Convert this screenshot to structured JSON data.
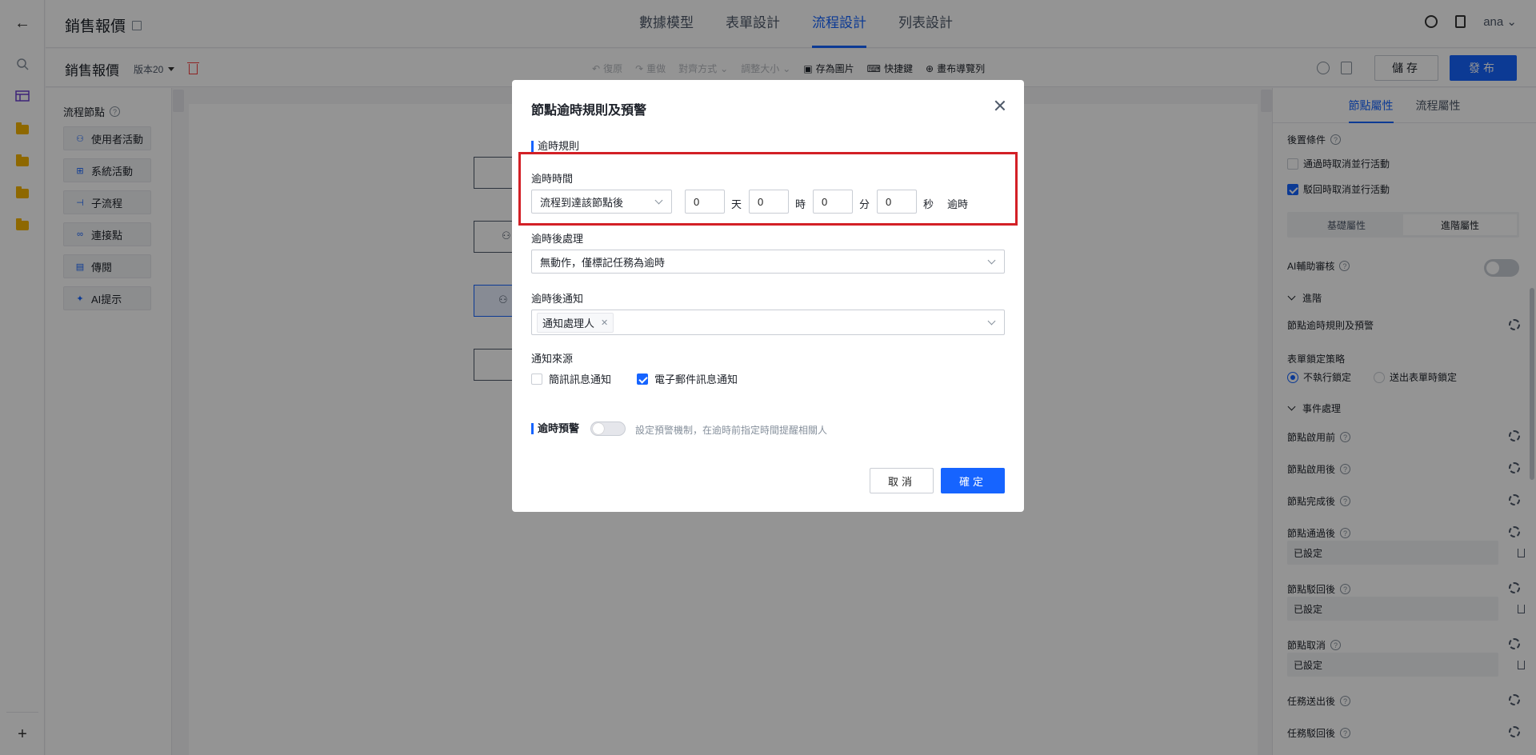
{
  "app": {
    "title": "銷售報價"
  },
  "nav": {
    "tabs": [
      "數據模型",
      "表單設計",
      "流程設計",
      "列表設計"
    ],
    "active": "流程設計"
  },
  "user": {
    "name": "ana"
  },
  "toolbar": {
    "doc_title": "銷售報價",
    "version": "版本20",
    "undo": "復原",
    "redo": "重做",
    "align": "對齊方式",
    "resize": "調整大小",
    "save_image": "存為圖片",
    "shortcuts": "快捷鍵",
    "guide": "畫布導覽列",
    "save": "儲存",
    "publish": "發布"
  },
  "nodes": {
    "title": "流程節點",
    "items": [
      {
        "label": "使用者活動",
        "icon": "user-icon"
      },
      {
        "label": "系統活動",
        "icon": "grid-icon"
      },
      {
        "label": "子流程",
        "icon": "subflow-icon"
      },
      {
        "label": "連接點",
        "icon": "link-icon"
      },
      {
        "label": "傳閱",
        "icon": "circulate-icon"
      },
      {
        "label": "AI提示",
        "icon": "ai-icon"
      }
    ]
  },
  "rpanel": {
    "tabs": [
      "節點屬性",
      "流程屬性"
    ],
    "post_condition": "後置條件",
    "cb1": "通過時取消並行活動",
    "cb2": "駁回時取消並行活動",
    "seg": [
      "基礎屬性",
      "進階屬性"
    ],
    "ai_review": "AI輔助審核",
    "advanced": "進階",
    "node_overtime": "節點逾時規則及預警",
    "lock_policy": "表單鎖定策略",
    "lock_opt1": "不執行鎖定",
    "lock_opt2": "送出表單時鎖定",
    "events": "事件處理",
    "e1": "節點啟用前",
    "e2": "節點啟用後",
    "e3": "節點完成後",
    "e4": "節點通過後",
    "e5": "節點駁回後",
    "e6": "節點取消",
    "e7": "任務送出後",
    "e8": "任務駁回後",
    "set": "已設定"
  },
  "modal": {
    "title": "節點逾時規則及預警",
    "sec_rule": "逾時規則",
    "overtime_label": "逾時時間",
    "base_select": "流程到達該節點後",
    "days": "0",
    "days_unit": "天",
    "hours": "0",
    "hours_unit": "時",
    "minutes": "0",
    "minutes_unit": "分",
    "seconds": "0",
    "seconds_unit": "秒",
    "suffix": "逾時",
    "after_label": "逾時後處理",
    "after_value": "無動作，僅標記任務為逾時",
    "notify_label": "逾時後通知",
    "notify_tag": "通知處理人",
    "source_label": "通知來源",
    "src_sms": "簡訊訊息通知",
    "src_email": "電子郵件訊息通知",
    "warn_label": "逾時預警",
    "warn_hint": "設定預警機制，在逾時前指定時間提醒相關人",
    "cancel": "取消",
    "ok": "確定"
  }
}
